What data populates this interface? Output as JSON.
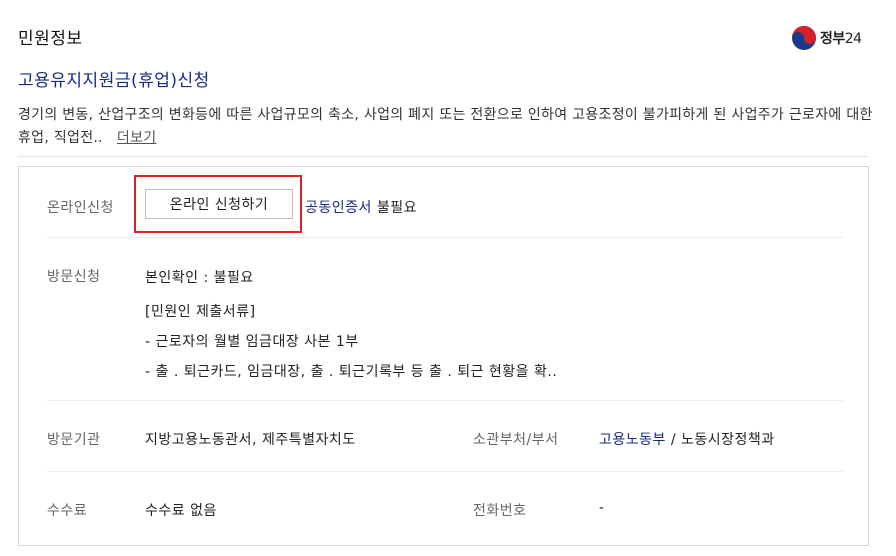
{
  "header": {
    "section_title": "민원정보",
    "logo_text_bold": "정부",
    "logo_text_num": "24"
  },
  "service": {
    "title": "고용유지지원금(휴업)신청",
    "description": "경기의 변동, 산업구조의 변화등에 따른 사업규모의 축소, 사업의 폐지 또는 전환으로 인하여 고용조정이 불가피하게 된 사업주가 근로자에 대한 휴업, 직업전..",
    "more_label": "더보기"
  },
  "online": {
    "label": "온라인신청",
    "button_label": "온라인 신청하기",
    "cert_link": "공동인증서",
    "cert_suffix": " 불필요"
  },
  "visit": {
    "label": "방문신청",
    "identity": "본인확인 : 불필요",
    "docs_header": "[민원인 제출서류]",
    "doc_1": "- 근로자의 월별 임금대장 사본 1부",
    "doc_2": "- 출 . 퇴근카드, 임금대장, 출 . 퇴근기록부 등 출 . 퇴근 현황을 확.."
  },
  "agency": {
    "label": "방문기관",
    "value": "지방고용노동관서, 제주특별자치도",
    "dept_label": "소관부처/부서",
    "dept_link": "고용노동부",
    "dept_suffix": " / 노동시장정책과"
  },
  "fee": {
    "label": "수수료",
    "value": "수수료 없음",
    "phone_label": "전화번호",
    "phone_value": "-"
  },
  "colors": {
    "link_navy": "#1a2a80",
    "highlight_red": "#e02020"
  }
}
